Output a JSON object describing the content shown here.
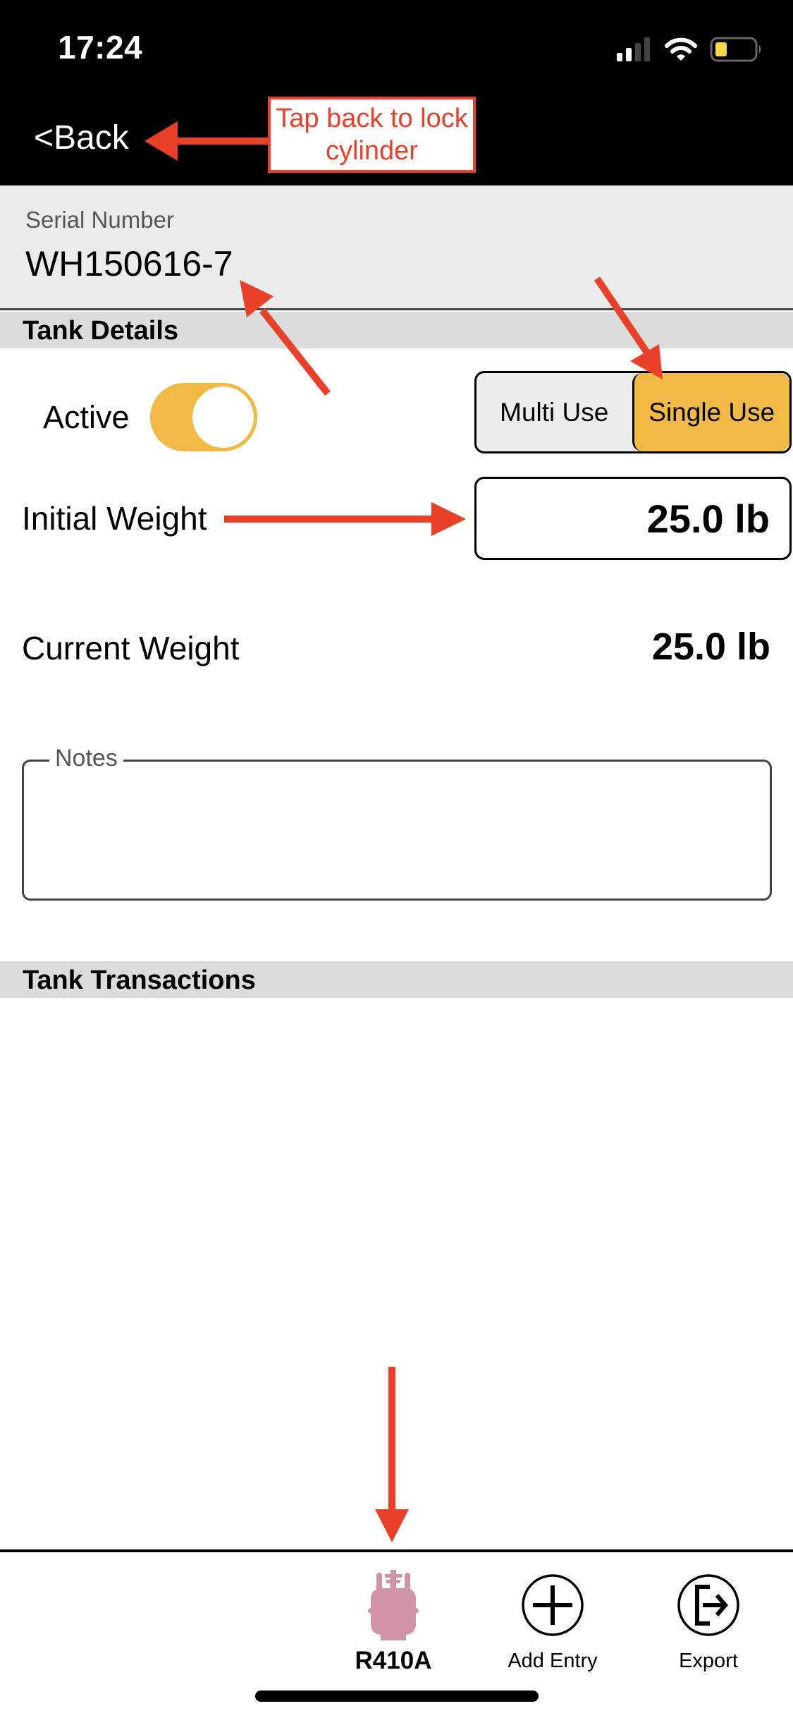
{
  "status_bar": {
    "time": "17:24",
    "icons": [
      "cellular-signal-icon",
      "wifi-icon",
      "battery-icon"
    ],
    "battery_color": "#f8d848"
  },
  "nav": {
    "back_label": "<Back"
  },
  "serial": {
    "label": "Serial Number",
    "value": "WH150616-7"
  },
  "tank_details": {
    "header": "Tank Details",
    "active_label": "Active",
    "active_on": true,
    "use_type": {
      "options": [
        "Multi Use",
        "Single Use"
      ],
      "selected": "Single Use"
    },
    "initial_weight": {
      "label": "Initial Weight",
      "value": "25.0 lb"
    },
    "current_weight": {
      "label": "Current Weight",
      "value": "25.0 lb"
    },
    "notes": {
      "label": "Notes",
      "value": ""
    }
  },
  "tank_transactions": {
    "header": "Tank Transactions",
    "items": []
  },
  "tab_bar": {
    "items": [
      {
        "label": "R410A",
        "icon": "refrigerant-cylinder-icon",
        "icon_color": "#cf94a8"
      },
      {
        "label": "Add Entry",
        "icon": "add-circle-icon"
      },
      {
        "label": "Export",
        "icon": "export-icon"
      }
    ]
  },
  "annotations": {
    "callout_text": "Tap back to lock cylinder",
    "color": "#e94129"
  },
  "colors": {
    "accent": "#f0b844",
    "header_bg": "#000000",
    "section_bg": "#dcdcdc",
    "field_bg": "#ebebeb"
  }
}
